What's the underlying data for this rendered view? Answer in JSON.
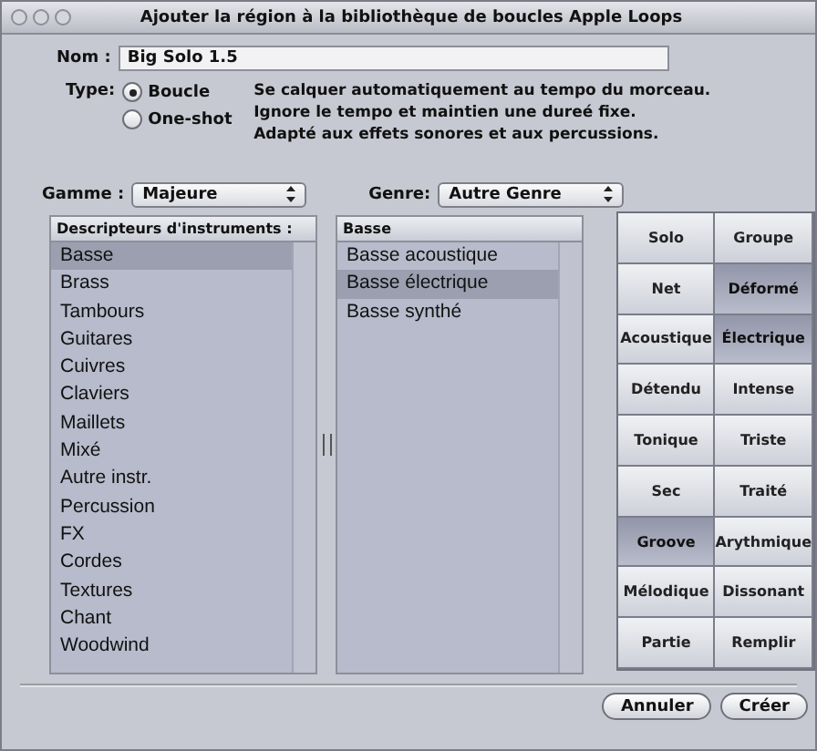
{
  "window": {
    "title": "Ajouter la région à la bibliothèque de boucles Apple Loops"
  },
  "name_field": {
    "label": "Nom :",
    "value": "Big Solo 1.5"
  },
  "type": {
    "label": "Type:",
    "options": [
      {
        "label": "Boucle",
        "selected": true
      },
      {
        "label": "One-shot",
        "selected": false
      }
    ],
    "description": [
      "Se calquer automatiquement au tempo du morceau.",
      "Ignore le tempo et maintien  une dureé fixe.",
      "Adapté aux effets sonores et aux percussions."
    ]
  },
  "scale": {
    "label": "Gamme :",
    "value": "Majeure"
  },
  "genre": {
    "label": "Genre:",
    "value": "Autre Genre"
  },
  "instruments": {
    "header": "Descripteurs d'instruments :",
    "items": [
      {
        "label": "Basse",
        "selected": true
      },
      {
        "label": "Brass",
        "selected": false
      },
      {
        "label": "Tambours",
        "selected": false
      },
      {
        "label": "Guitares",
        "selected": false
      },
      {
        "label": "Cuivres",
        "selected": false
      },
      {
        "label": "Claviers",
        "selected": false
      },
      {
        "label": "Maillets",
        "selected": false
      },
      {
        "label": "Mixé",
        "selected": false
      },
      {
        "label": "Autre instr.",
        "selected": false
      },
      {
        "label": "Percussion",
        "selected": false
      },
      {
        "label": "FX",
        "selected": false
      },
      {
        "label": "Cordes",
        "selected": false
      },
      {
        "label": "Textures",
        "selected": false
      },
      {
        "label": "Chant",
        "selected": false
      },
      {
        "label": "Woodwind",
        "selected": false
      }
    ]
  },
  "subtypes": {
    "header": "Basse",
    "items": [
      {
        "label": "Basse acoustique",
        "selected": false
      },
      {
        "label": "Basse électrique",
        "selected": true
      },
      {
        "label": "Basse synthé",
        "selected": false
      }
    ]
  },
  "descriptors": [
    {
      "label": "Solo",
      "selected": false
    },
    {
      "label": "Groupe",
      "selected": false
    },
    {
      "label": "Net",
      "selected": false
    },
    {
      "label": "Déformé",
      "selected": true
    },
    {
      "label": "Acoustique",
      "selected": false
    },
    {
      "label": "Électrique",
      "selected": true
    },
    {
      "label": "Détendu",
      "selected": false
    },
    {
      "label": "Intense",
      "selected": false
    },
    {
      "label": "Tonique",
      "selected": false
    },
    {
      "label": "Triste",
      "selected": false
    },
    {
      "label": "Sec",
      "selected": false
    },
    {
      "label": "Traité",
      "selected": false
    },
    {
      "label": "Groove",
      "selected": true
    },
    {
      "label": "Arythmique",
      "selected": false
    },
    {
      "label": "Mélodique",
      "selected": false
    },
    {
      "label": "Dissonant",
      "selected": false
    },
    {
      "label": "Partie",
      "selected": false
    },
    {
      "label": "Remplir",
      "selected": false
    }
  ],
  "buttons": [
    {
      "label": "Annuler"
    },
    {
      "label": "Créer"
    }
  ]
}
